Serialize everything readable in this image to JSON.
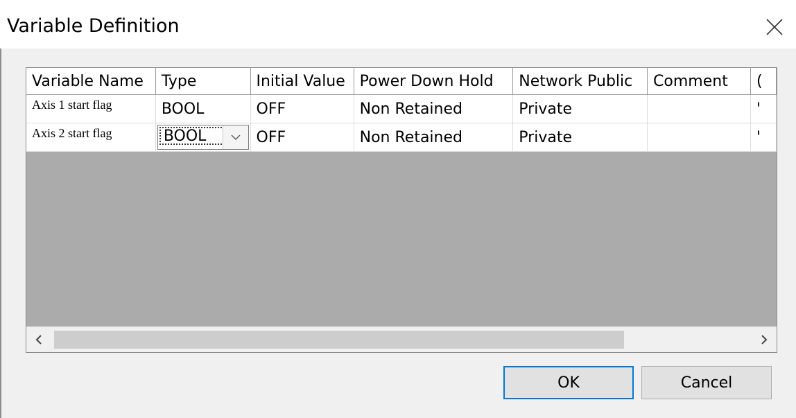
{
  "dialog": {
    "title": "Variable Definition"
  },
  "grid": {
    "columns": [
      "Variable Name",
      "Type",
      "Initial Value",
      "Power Down Hold",
      "Network Public",
      "Comment",
      "("
    ],
    "rows": [
      {
        "name": "Axis 1 start flag",
        "type": "BOOL",
        "initial": "OFF",
        "power_down_hold": "Non Retained",
        "network_public": "Private",
        "comment": "",
        "extra": "'"
      },
      {
        "name": "Axis 2 start flag",
        "type": "BOOL",
        "initial": "OFF",
        "power_down_hold": "Non Retained",
        "network_public": "Private",
        "comment": "",
        "extra": "'"
      }
    ]
  },
  "buttons": {
    "ok": "OK",
    "cancel": "Cancel"
  },
  "icons": {
    "close": "close-icon",
    "dropdown": "chevron-down-icon",
    "scroll_left": "chevron-left-icon",
    "scroll_right": "chevron-right-icon"
  },
  "colors": {
    "accent": "#0078d7",
    "grid_background": "#ababab"
  }
}
